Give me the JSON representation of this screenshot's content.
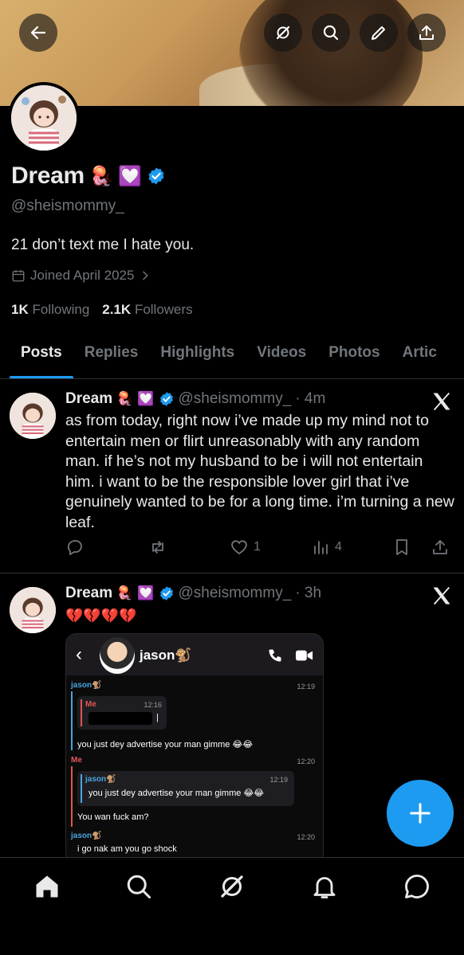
{
  "profile": {
    "display_name": "Dream",
    "handle": "@sheismommy_",
    "bio": "21 don’t text me I hate you.",
    "joined": "Joined April 2025",
    "following_count": "1K",
    "following_label": "Following",
    "followers_count": "2.1K",
    "followers_label": "Followers",
    "emojis": [
      "🪼",
      "💟"
    ]
  },
  "tabs": [
    "Posts",
    "Replies",
    "Highlights",
    "Videos",
    "Photos",
    "Artic"
  ],
  "posts": [
    {
      "name": "Dream",
      "handle": "@sheismommy_",
      "time": "· 4m",
      "text": "as from today, right now i’ve made up my mind not to entertain men or flirt unreasonably with any random man. if he’s not my husband to be i will not entertain him. i want to be the responsible lover girl that i’ve genuinely wanted to be for a long time. i’m turning a new leaf.",
      "likes": "1",
      "views": "4"
    },
    {
      "name": "Dream",
      "handle": "@sheismommy_",
      "time": "· 3h",
      "text": "💔💔💔💔",
      "embed": {
        "contact": "jason🐒",
        "messages": [
          {
            "sender": "jason🐒",
            "time": "12:19",
            "quote_sender": "Me",
            "quote_time": "12:16",
            "text": "you just dey advertise your man gimme 😂😂"
          },
          {
            "sender": "Me",
            "time": "12:20",
            "quote_sender": "jason🐒",
            "quote_time": "12:19",
            "quote_text": "you just dey advertise your man gimme 😂😂",
            "text": "You wan fuck am?"
          },
          {
            "sender": "jason🐒",
            "time": "12:20",
            "text": "i go nak am you go shock"
          }
        ]
      }
    }
  ],
  "colors": {
    "accent": "#1d9bf0",
    "muted": "#71767b",
    "text": "#e7e9ea",
    "background": "#000000"
  }
}
